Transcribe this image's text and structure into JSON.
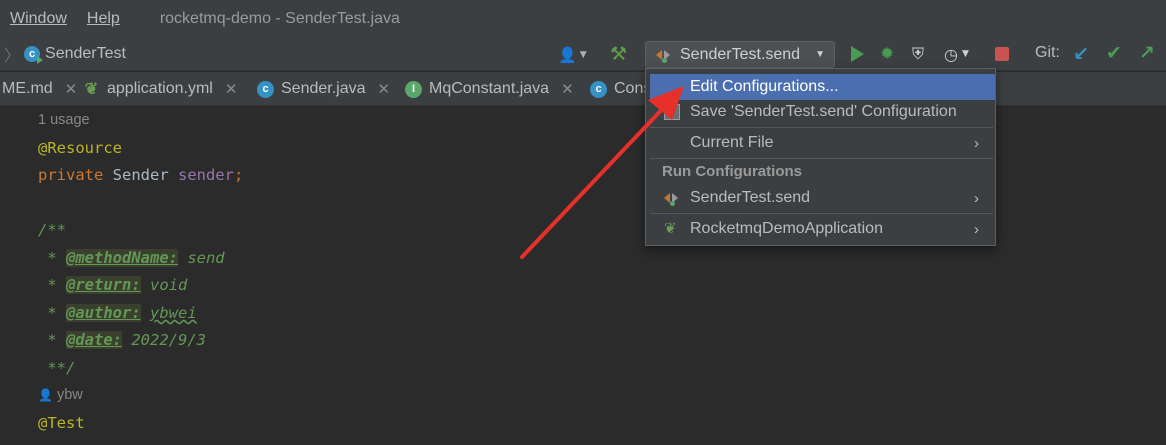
{
  "menubar": {
    "window_label": "Window",
    "help_label": "Help",
    "title": "rocketmq-demo - SenderTest.java"
  },
  "toolbar": {
    "breadcrumb": "SenderTest",
    "run_config": "SenderTest.send",
    "git_label": "Git:"
  },
  "tabs": [
    {
      "label": "ME.md",
      "icon": "markdown-icon"
    },
    {
      "label": "application.yml",
      "icon": "spring-leaf-icon"
    },
    {
      "label": "Sender.java",
      "icon": "class-icon"
    },
    {
      "label": "MqConstant.java",
      "icon": "interface-icon"
    },
    {
      "label": "Cons",
      "icon": "class-icon"
    }
  ],
  "editor": {
    "usage_hint": "1 usage",
    "resource_annotation": "@Resource",
    "field_kw": "private",
    "field_type": " Sender ",
    "field_name": "sender",
    "field_semicolon": ";",
    "doc_open": "/**",
    "doc_star": " * ",
    "tag_method": "@methodName:",
    "val_method": " send",
    "tag_return": "@return:",
    "val_return": " void",
    "tag_author": "@author:",
    "val_author": "ybwei",
    "tag_date": "@date:",
    "val_date": " 2022/9/3",
    "doc_close": " **/",
    "author_hint": "ybw",
    "test_annotation": "@Test"
  },
  "popup": {
    "edit_configurations": "Edit Configurations...",
    "save_configuration": "Save 'SenderTest.send' Configuration",
    "current_file": "Current File",
    "run_configurations_header": "Run Configurations",
    "run_config_1": "SenderTest.send",
    "run_config_2": "RocketmqDemoApplication"
  },
  "colors": {
    "accent_selection": "#4b6eaf",
    "annotation_arrow": "#e8302a",
    "run_green": "#499c54",
    "stop_red": "#c75450"
  }
}
